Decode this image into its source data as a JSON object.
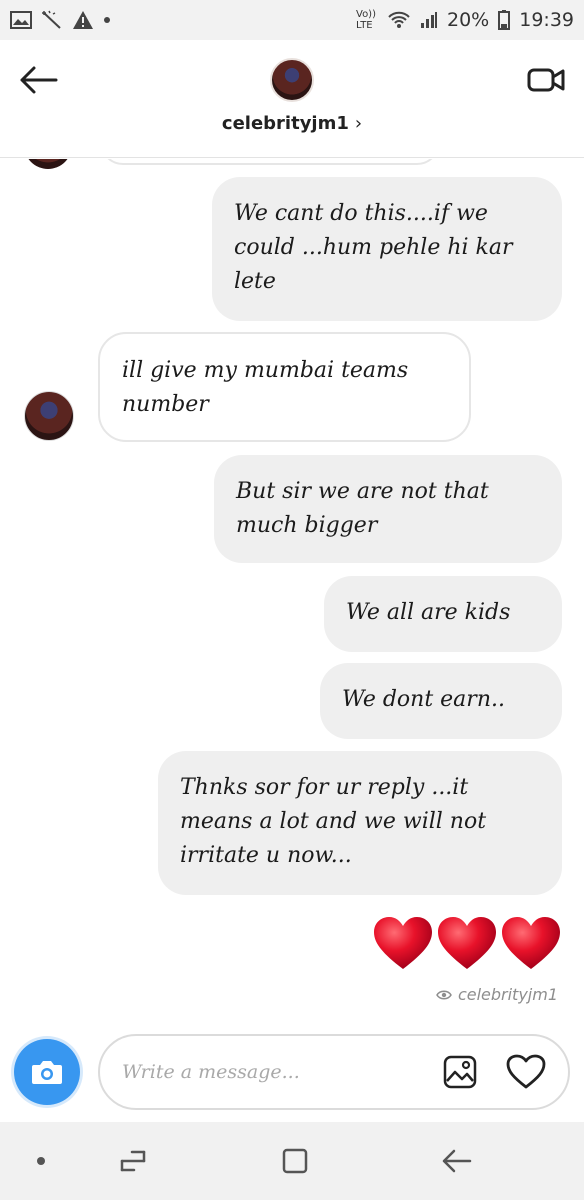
{
  "status_bar": {
    "network": "Vo)) LTE",
    "battery": "20%",
    "time": "19:39",
    "icons": [
      "image-icon",
      "wand-icon",
      "warning-icon",
      "dot-icon",
      "wifi-icon",
      "signal-icon",
      "battery-icon"
    ]
  },
  "header": {
    "username": "celebrityjm1",
    "chevron": "›",
    "back_icon": "arrow-left-icon",
    "video_icon": "video-camera-icon"
  },
  "messages": [
    {
      "side": "out",
      "text": "We cant do this....if we could ...hum pehle hi kar lete"
    },
    {
      "side": "in",
      "text": "ill give my mumbai teams number"
    },
    {
      "side": "out",
      "text": "But sir we are not that much bigger"
    },
    {
      "side": "out",
      "text": "We all are kids"
    },
    {
      "side": "out",
      "text": "We dont earn.."
    },
    {
      "side": "out",
      "text": "Thnks sor for ur reply ...it means a lot and we will not irritate u now..."
    }
  ],
  "hearts": [
    "heart-emoji",
    "heart-emoji",
    "heart-emoji"
  ],
  "seen_by": "celebrityjm1",
  "composer": {
    "placeholder": "Write a message...",
    "value": ""
  },
  "colors": {
    "accent": "#3897f0",
    "outgoing_bubble": "#efefef",
    "heart": "#e8122a"
  },
  "nav_bar": {
    "icons": [
      "dot-icon",
      "recents-icon",
      "home-icon",
      "back-icon"
    ]
  }
}
